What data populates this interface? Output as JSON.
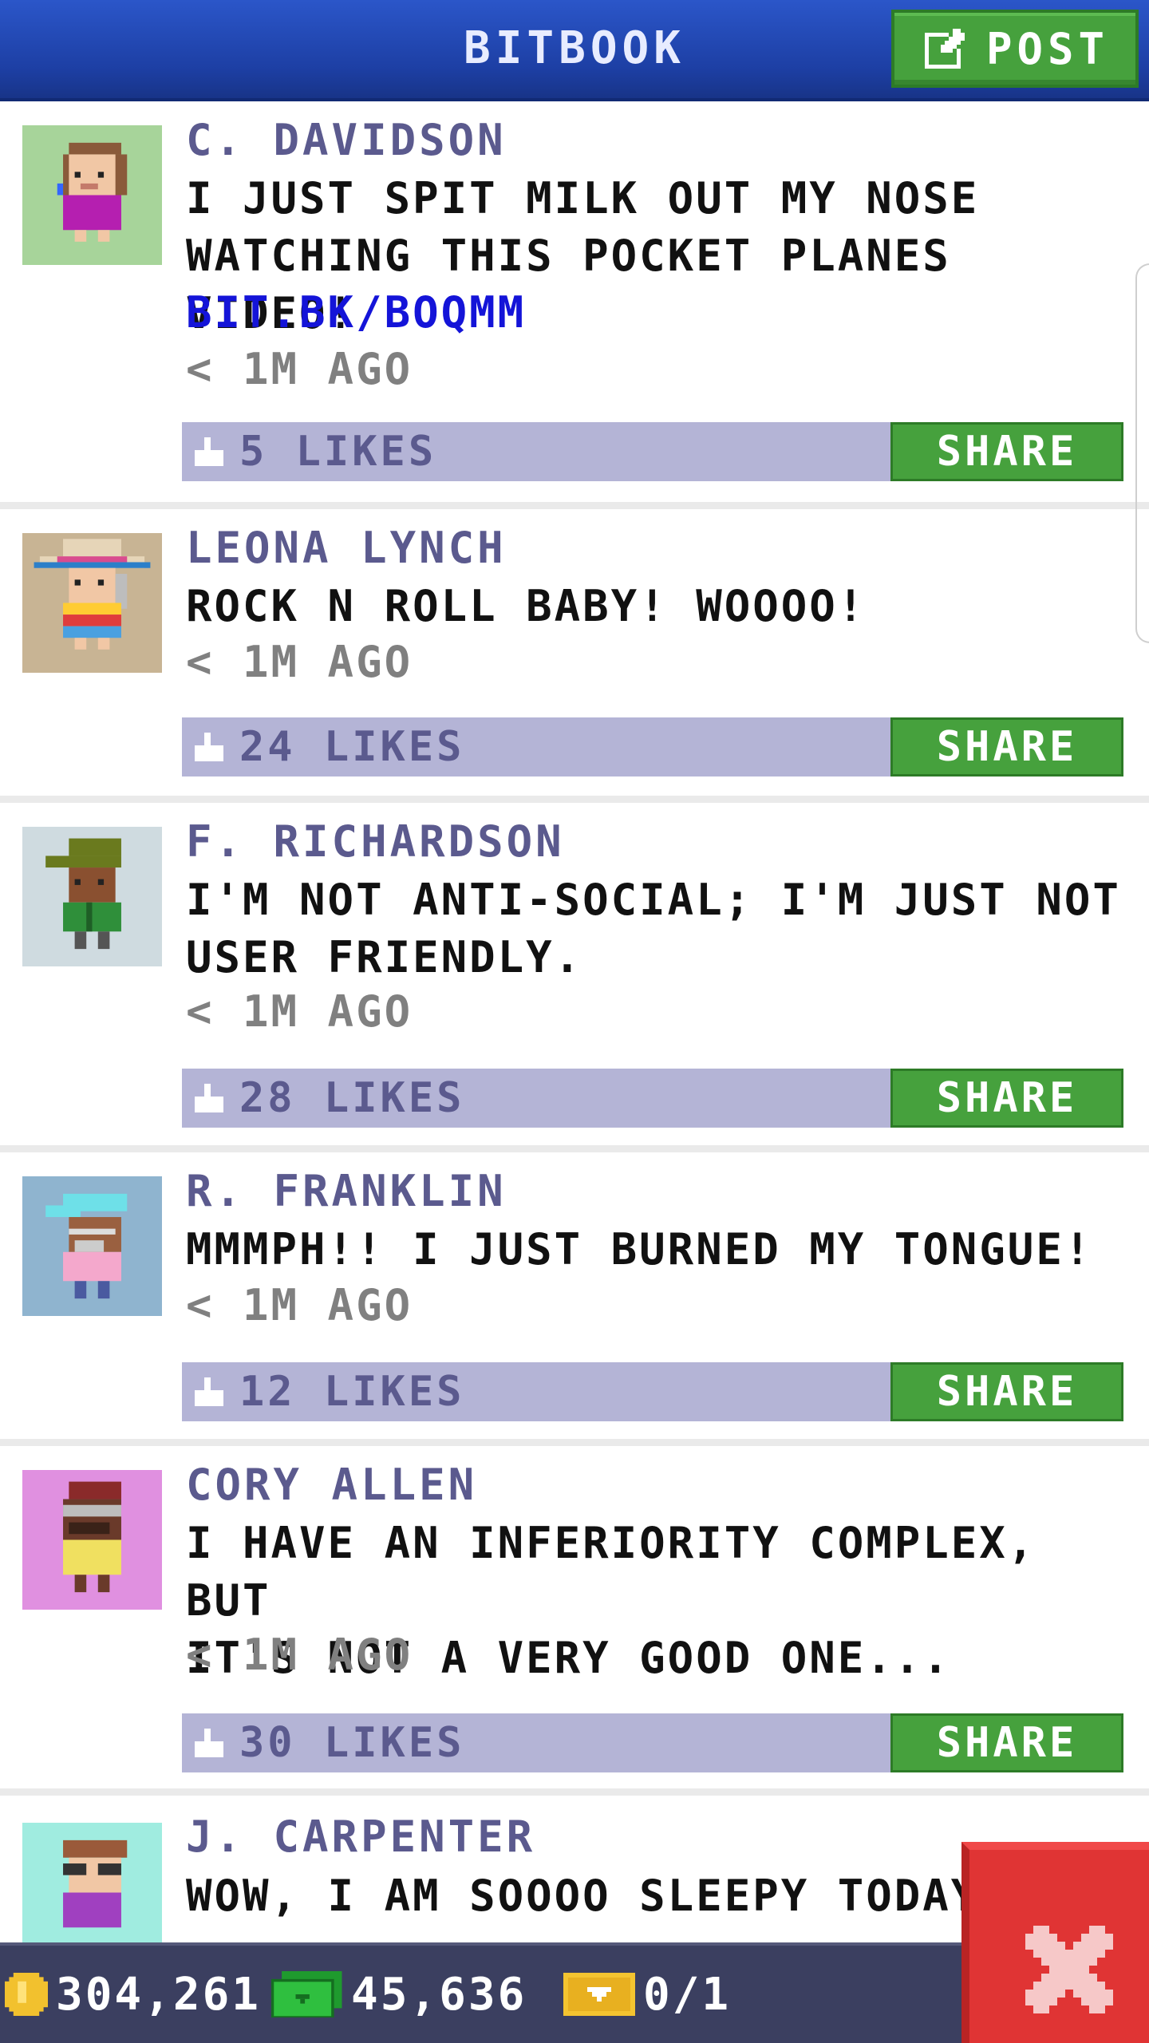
{
  "header": {
    "title": "BITBOOK",
    "post_label": "POST"
  },
  "posts": [
    {
      "author": "C. DAVIDSON",
      "message": "I JUST SPIT MILK OUT MY NOSE\nWATCHING THIS POCKET PLANES VIDEO!",
      "link": "BIT.BK/BOQMM",
      "time": "< 1M AGO",
      "likes": "5 LIKES",
      "share": "SHARE",
      "avatar_bg": "#a7d49a"
    },
    {
      "author": "LEONA LYNCH",
      "message": "ROCK N ROLL BABY! WOOOO!",
      "time": "< 1M AGO",
      "likes": "24 LIKES",
      "share": "SHARE",
      "avatar_bg": "#c8b494"
    },
    {
      "author": "F. RICHARDSON",
      "message": "I'M NOT ANTI-SOCIAL; I'M JUST NOT\nUSER FRIENDLY.",
      "time": "< 1M AGO",
      "likes": "28 LIKES",
      "share": "SHARE",
      "avatar_bg": "#cfdbe0"
    },
    {
      "author": "R. FRANKLIN",
      "message": "MMMPH!! I JUST BURNED MY TONGUE!",
      "time": "< 1M AGO",
      "likes": "12 LIKES",
      "share": "SHARE",
      "avatar_bg": "#8fb4cf"
    },
    {
      "author": "CORY ALLEN",
      "message": "I HAVE AN INFERIORITY COMPLEX, BUT\nIT'S NOT A VERY GOOD ONE...",
      "time": "< 1M AGO",
      "likes": "30 LIKES",
      "share": "SHARE",
      "avatar_bg": "#e090e0"
    },
    {
      "author": "J. CARPENTER",
      "message": "WOW, I AM SOOOO SLEEPY TODAY",
      "avatar_bg": "#a0ece0"
    }
  ],
  "status": {
    "coins": "304,261",
    "bux": "45,636",
    "tickets": "0/1"
  },
  "colors": {
    "header": "#1d3fa4",
    "green": "#46a13d",
    "likebar": "#b4b4d6",
    "name": "#5b5a8e",
    "link": "#1414d8",
    "close": "#e03434"
  }
}
